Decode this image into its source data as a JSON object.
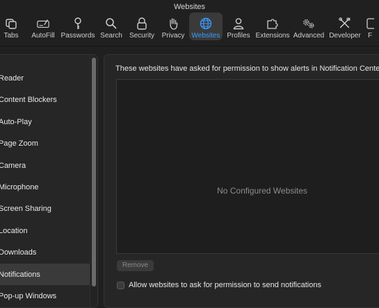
{
  "window": {
    "title": "Websites"
  },
  "toolbar": {
    "items": [
      {
        "label": "Tabs",
        "icon": "tabs-icon"
      },
      {
        "label": "AutoFill",
        "icon": "autofill-icon"
      },
      {
        "label": "Passwords",
        "icon": "key-icon"
      },
      {
        "label": "Search",
        "icon": "search-icon"
      },
      {
        "label": "Security",
        "icon": "lock-icon"
      },
      {
        "label": "Privacy",
        "icon": "hand-icon"
      },
      {
        "label": "Websites",
        "icon": "globe-icon"
      },
      {
        "label": "Profiles",
        "icon": "person-icon"
      },
      {
        "label": "Extensions",
        "icon": "puzzle-icon"
      },
      {
        "label": "Advanced",
        "icon": "gears-icon"
      },
      {
        "label": "Developer",
        "icon": "tools-icon"
      },
      {
        "label": "F",
        "icon": "feature-icon"
      }
    ],
    "selected": "Websites",
    "accent_color": "#3b9cff"
  },
  "sidebar": {
    "items": [
      {
        "label": "Reader"
      },
      {
        "label": "Content Blockers"
      },
      {
        "label": "Auto-Play"
      },
      {
        "label": "Page Zoom"
      },
      {
        "label": "Camera"
      },
      {
        "label": "Microphone"
      },
      {
        "label": "Screen Sharing"
      },
      {
        "label": "Location"
      },
      {
        "label": "Downloads"
      },
      {
        "label": "Notifications"
      },
      {
        "label": "Pop-up Windows"
      }
    ],
    "selected": "Notifications"
  },
  "content": {
    "description": "These websites have asked for permission to show alerts in Notification Cente",
    "empty_message": "No Configured Websites",
    "remove_label": "Remove",
    "checkbox_label": "Allow websites to ask for permission to send notifications",
    "checkbox_checked": false
  }
}
